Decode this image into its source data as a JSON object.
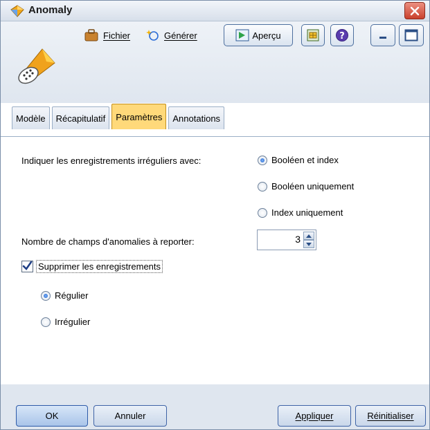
{
  "window": {
    "title": "Anomaly"
  },
  "toolbar": {
    "file_label": "Fichier",
    "generate_label": "Générer",
    "preview_label": "Aperçu"
  },
  "tabs": [
    {
      "label": "Modèle",
      "active": false
    },
    {
      "label": "Récapitulatif",
      "active": false
    },
    {
      "label": "Paramètres",
      "active": true
    },
    {
      "label": "Annotations",
      "active": false
    }
  ],
  "settings": {
    "flag_label": "Indiquer les enregistrements irréguliers avec:",
    "flag_options": [
      {
        "label": "Booléen et index",
        "selected": true
      },
      {
        "label": "Booléen uniquement",
        "selected": false
      },
      {
        "label": "Index uniquement",
        "selected": false
      }
    ],
    "num_fields_label": "Nombre de champs d'anomalies à reporter:",
    "num_fields_value": "3",
    "discard_label": "Supprimer les enregistrements",
    "discard_checked": true,
    "discard_options": [
      {
        "label": "Régulier",
        "selected": true
      },
      {
        "label": "Irrégulier",
        "selected": false
      }
    ]
  },
  "buttons": {
    "ok": "OK",
    "cancel": "Annuler",
    "apply": "Appliquer",
    "reset": "Réinitialiser"
  },
  "colors": {
    "active_tab": "#ffd97a",
    "close_button": "#c9402c",
    "accent": "#1d5fcf"
  }
}
